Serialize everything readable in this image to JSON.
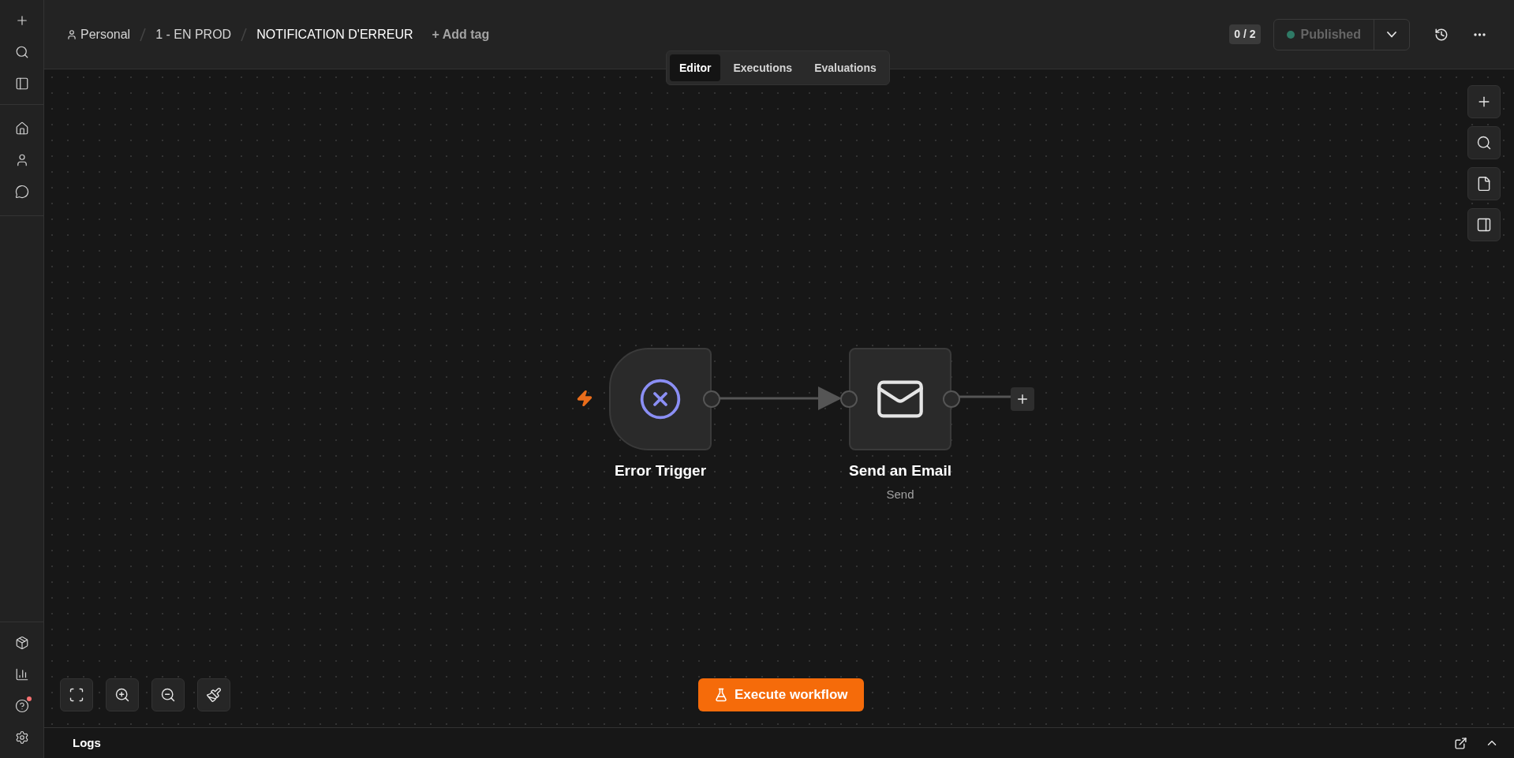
{
  "breadcrumbs": [
    {
      "kind": "project",
      "label": "Personal"
    },
    {
      "kind": "folder",
      "label": "1 - EN PROD"
    },
    {
      "kind": "workflow",
      "label": "NOTIFICATION D'ERREUR"
    }
  ],
  "add_tag": "+ Add tag",
  "counter": "0 / 2",
  "publish": {
    "label": "Published",
    "published": true
  },
  "tabs": [
    {
      "label": "Editor",
      "selected": true
    },
    {
      "label": "Executions",
      "selected": false
    },
    {
      "label": "Evaluations",
      "selected": false
    }
  ],
  "nodes": [
    {
      "kind": "trigger",
      "name": "Error Trigger"
    },
    {
      "kind": "email",
      "name": "Send an Email",
      "subtitle": "Send"
    }
  ],
  "execute_button": "Execute workflow",
  "help_notification": true,
  "logs": {
    "label": "Logs"
  }
}
